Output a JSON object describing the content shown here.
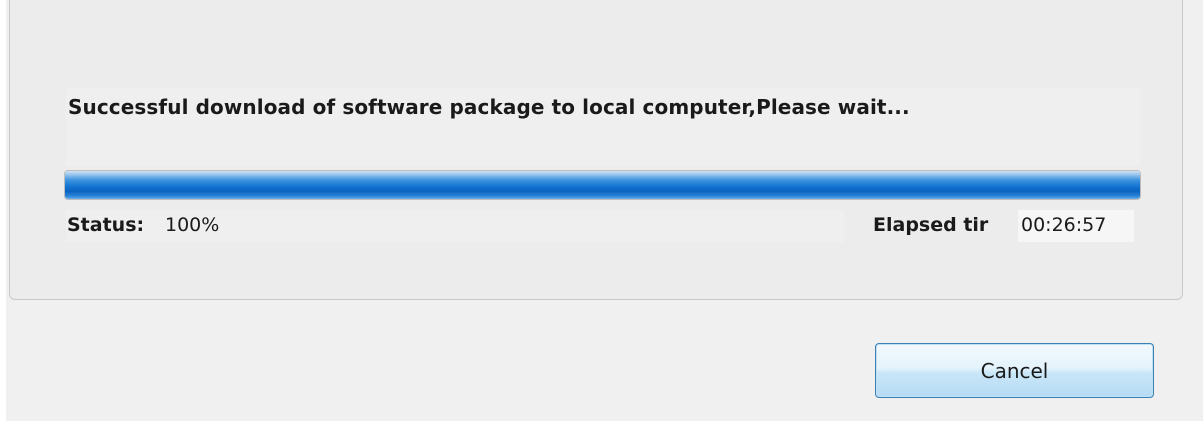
{
  "message": {
    "text": "Successful download of software package to local computer,Please wait..."
  },
  "progress": {
    "fraction": 1.0
  },
  "status": {
    "label": "Status:",
    "value": "100%"
  },
  "elapsed": {
    "label": "Elapsed tir",
    "value": "00:26:57"
  },
  "buttons": {
    "cancel_label": "Cancel"
  },
  "colors": {
    "window_bg": "#f0f0f0",
    "progress_fill": "#1474d1",
    "button_border": "#3c7fb1"
  }
}
